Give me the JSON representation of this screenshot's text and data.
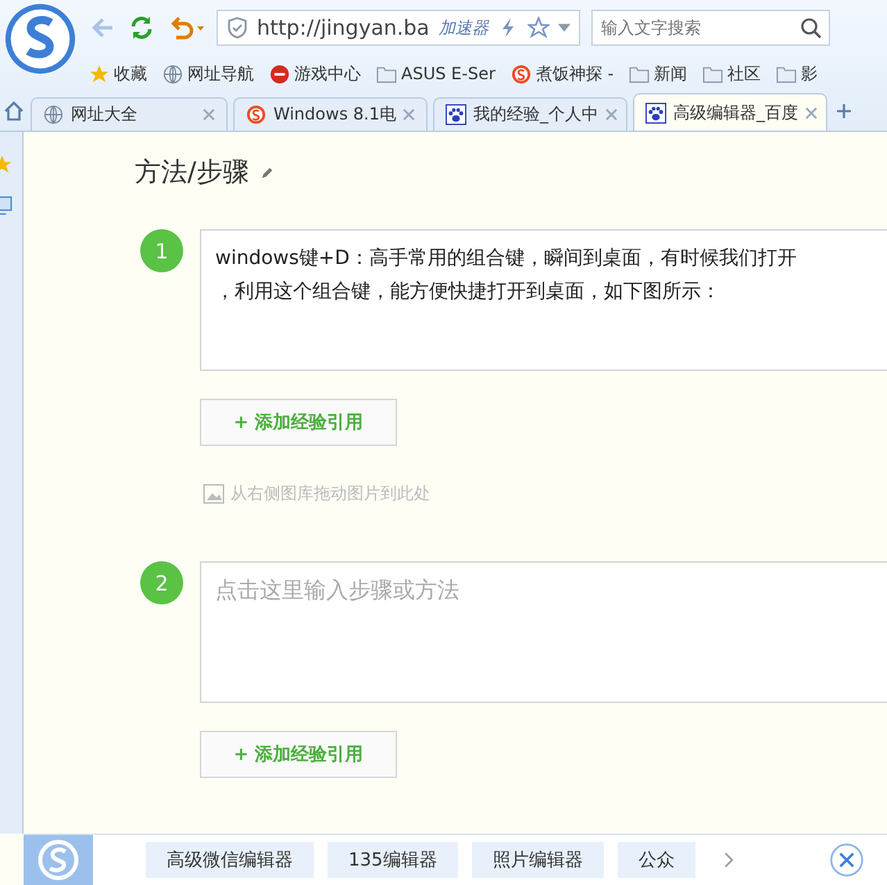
{
  "toolbar": {
    "url": "http://jingyan.ba",
    "accelerator": "加速器",
    "search": {
      "placeholder": "输入文字搜索"
    }
  },
  "bookmarks": [
    {
      "label": "收藏",
      "kind": "star"
    },
    {
      "label": "网址导航",
      "kind": "globe"
    },
    {
      "label": "游戏中心",
      "kind": "game"
    },
    {
      "label": "ASUS E-Ser",
      "kind": "folder"
    },
    {
      "label": "煮饭神探 -",
      "kind": "sogou"
    },
    {
      "label": "新闻",
      "kind": "folder"
    },
    {
      "label": "社区",
      "kind": "folder"
    },
    {
      "label": "影",
      "kind": "folder"
    }
  ],
  "tabs": [
    {
      "label": "网址大全",
      "kind": "globe",
      "selected": false
    },
    {
      "label": "Windows 8.1电",
      "kind": "sogou",
      "selected": false
    },
    {
      "label": "我的经验_个人中",
      "kind": "paw",
      "selected": false
    },
    {
      "label": "高级编辑器_百度",
      "kind": "paw",
      "selected": true
    }
  ],
  "section_title": "方法/步骤",
  "steps": [
    {
      "number": "1",
      "lines": [
        "windows键+D：高手常用的组合键，瞬间到桌面，有时候我们打开",
        "，利用这个组合键，能方便快捷打开到桌面，如下图所示："
      ],
      "add_button": "+ 添加经验引用",
      "image_hint": "从右侧图库拖动图片到此处"
    },
    {
      "number": "2",
      "placeholder": "点击这里输入步骤或方法",
      "add_button": "+ 添加经验引用"
    }
  ],
  "bottom_bar": {
    "items": [
      "高级微信编辑器",
      "135编辑器",
      "照片编辑器",
      "公众"
    ]
  }
}
